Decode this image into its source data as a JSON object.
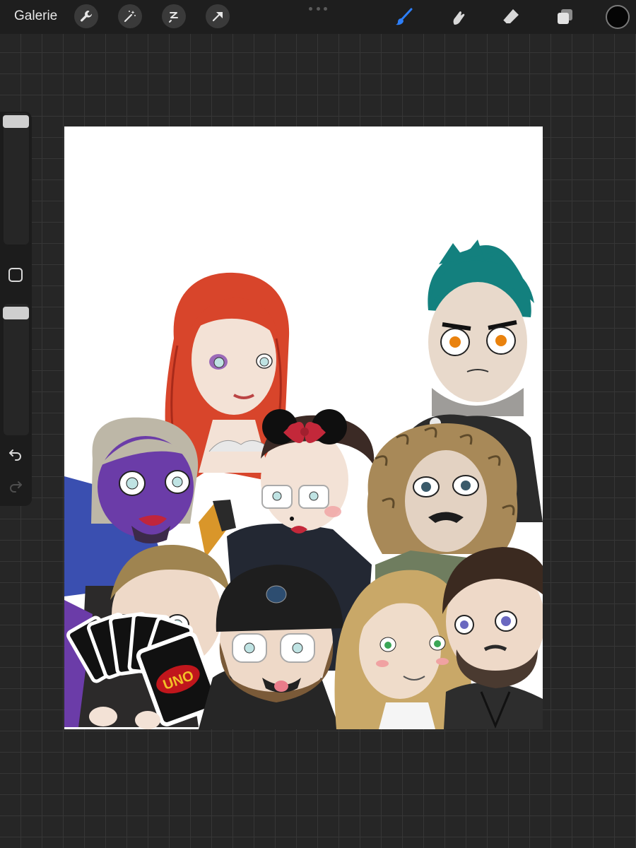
{
  "toolbar": {
    "gallery_label": "Galerie",
    "left_tools": [
      "wrench-icon",
      "magic-wand-icon",
      "selection-icon",
      "move-arrow-icon"
    ],
    "right_tools": [
      "brush-icon",
      "smudge-icon",
      "eraser-icon",
      "layers-icon"
    ],
    "active_tool": "brush",
    "active_color": "#050505",
    "accent_color": "#2d7ff9"
  },
  "sidebar": {
    "brush_size": 1.0,
    "opacity": 1.0,
    "undo_enabled": true,
    "redo_enabled": false
  },
  "canvas": {
    "artwork": "group-caricature",
    "cards_text": "UNO"
  }
}
